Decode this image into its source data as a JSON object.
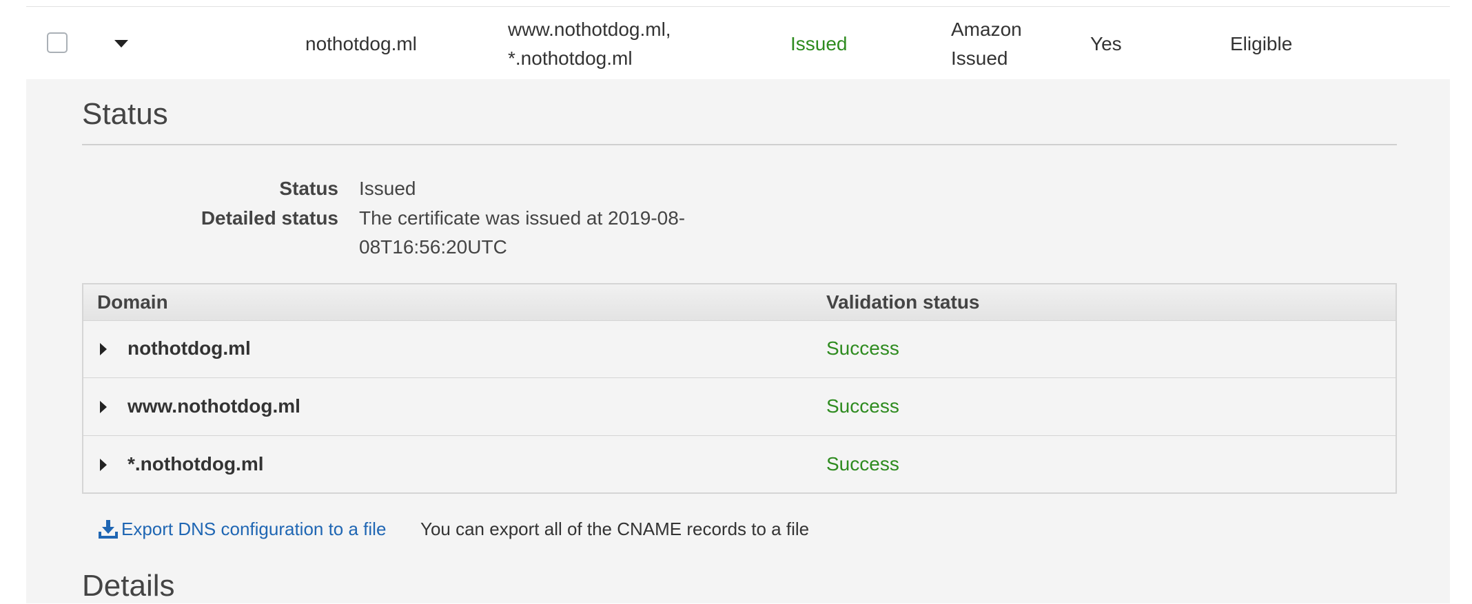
{
  "certificate_row": {
    "domain_name": "nothotdog.ml",
    "additional_names_line1": "www.nothotdog.ml,",
    "additional_names_line2": "*.nothotdog.ml",
    "status": "Issued",
    "type_line1": "Amazon",
    "type_line2": "Issued",
    "in_use": "Yes",
    "renewal_eligibility": "Eligible"
  },
  "status_section": {
    "title": "Status",
    "status_label": "Status",
    "status_value": "Issued",
    "detailed_status_label": "Detailed status",
    "detailed_status_line1": "The certificate was issued at 2019-08-",
    "detailed_status_line2": "08T16:56:20UTC"
  },
  "domain_table": {
    "headers": [
      "Domain",
      "Validation status"
    ],
    "rows": [
      {
        "domain": "nothotdog.ml",
        "status": "Success"
      },
      {
        "domain": "www.nothotdog.ml",
        "status": "Success"
      },
      {
        "domain": "*.nothotdog.ml",
        "status": "Success"
      }
    ]
  },
  "export": {
    "link_label": "Export DNS configuration to a file",
    "help_text": "You can export all of the CNAME records to a file",
    "icon": "download-icon"
  },
  "details_section": {
    "title": "Details"
  },
  "colors": {
    "success": "#2e8b1f",
    "link": "#1f66b3",
    "panel_background": "#f4f4f4"
  }
}
